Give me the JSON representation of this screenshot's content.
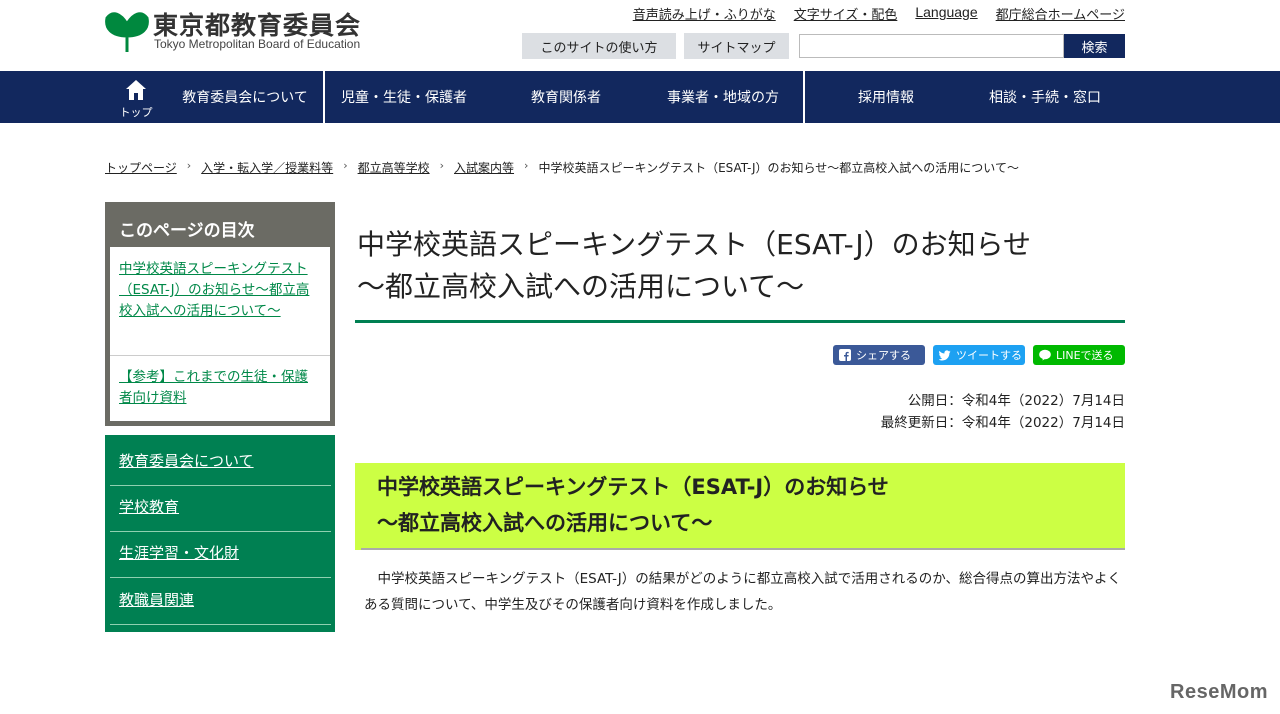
{
  "logo": {
    "jp": "東京都教育委員会",
    "en": "Tokyo Metropolitan Board of Education"
  },
  "top_links": [
    "音声読み上げ・ふりがな",
    "文字サイズ・配色",
    "Language",
    "都庁総合ホームページ"
  ],
  "utility": {
    "howto": "このサイトの使い方",
    "sitemap": "サイトマップ",
    "search_value": "",
    "search_button": "検索"
  },
  "nav": {
    "home_label": "トップ",
    "items": [
      "教育委員会について",
      "児童・生徒・保護者",
      "教育関係者",
      "事業者・地域の方",
      "採用情報",
      "相談・手続・窓口"
    ]
  },
  "breadcrumb": [
    "トップページ",
    "入学・転入学／授業料等",
    "都立高等学校",
    "入試案内等",
    "中学校英語スピーキングテスト（ESAT-J）のお知らせ～都立高校入試への活用について～"
  ],
  "toc": {
    "title": "このページの目次",
    "links": [
      "中学校英語スピーキングテスト（ESAT-J）のお知らせ～都立高校入試への活用について～",
      "【参考】これまでの生徒・保護者向け資料"
    ]
  },
  "side_menu": [
    "教育委員会について",
    "学校教育",
    "生涯学習・文化財",
    "教職員関連"
  ],
  "page": {
    "title_line1": "中学校英語スピーキングテスト（ESAT-J）のお知らせ",
    "title_line2": "～都立高校入試への活用について～",
    "share": {
      "facebook": "シェアする",
      "twitter": "ツイートする",
      "line": "LINEで送る"
    },
    "published": "公開日：令和4年（2022）7月14日",
    "updated": "最終更新日：令和4年（2022）7月14日",
    "h2_line1": "中学校英語スピーキングテスト（ESAT-J）のお知らせ",
    "h2_line2": "～都立高校入試への活用について～",
    "body": "中学校英語スピーキングテスト（ESAT-J）の結果がどのように都立高校入試で活用されるのか、総合得点の算出方法やよくある質問について、中学生及びその保護者向け資料を作成しました。"
  },
  "watermark": "ReseMom",
  "colors": {
    "navy": "#12285e",
    "green": "#008052",
    "lime": "#ccff44",
    "toc_grey": "#6b6b64",
    "facebook": "#3b5998",
    "twitter": "#1da1f2",
    "line": "#00b900"
  }
}
